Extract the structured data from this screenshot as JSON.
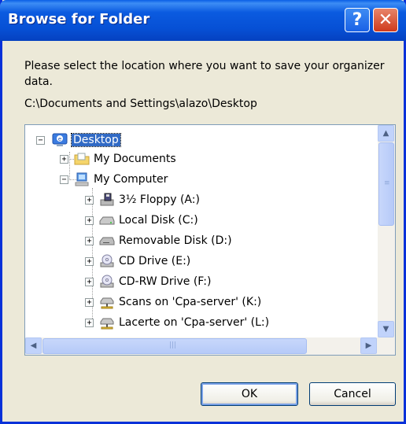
{
  "window": {
    "title": "Browse for Folder",
    "help_label": "?",
    "close_label": "✕"
  },
  "dialog": {
    "instruction": "Please select the location where you want to save your organizer data.",
    "path": "C:\\Documents and Settings\\alazo\\Desktop"
  },
  "tree": {
    "items": [
      {
        "label": "Desktop",
        "icon": "desktop-icon",
        "expander": "−",
        "selected": true
      },
      {
        "label": "My Documents",
        "icon": "folder-documents-icon",
        "expander": "+"
      },
      {
        "label": "My Computer",
        "icon": "computer-icon",
        "expander": "−"
      },
      {
        "label": "3½ Floppy (A:)",
        "icon": "floppy-drive-icon",
        "expander": "+"
      },
      {
        "label": "Local Disk (C:)",
        "icon": "hard-disk-icon",
        "expander": "+"
      },
      {
        "label": "Removable Disk (D:)",
        "icon": "removable-disk-icon",
        "expander": "+"
      },
      {
        "label": "CD Drive (E:)",
        "icon": "cd-drive-icon",
        "expander": "+"
      },
      {
        "label": "CD-RW Drive (F:)",
        "icon": "cd-drive-icon",
        "expander": "+"
      },
      {
        "label": "Scans on 'Cpa-server' (K:)",
        "icon": "network-drive-icon",
        "expander": "+"
      },
      {
        "label": "Lacerte on 'Cpa-server' (L:)",
        "icon": "network-drive-icon",
        "expander": "+"
      }
    ]
  },
  "buttons": {
    "ok": "OK",
    "cancel": "Cancel"
  },
  "colors": {
    "titlebar": "#0650D5",
    "dialog_bg": "#ECE9D8",
    "selection": "#316AC5"
  }
}
